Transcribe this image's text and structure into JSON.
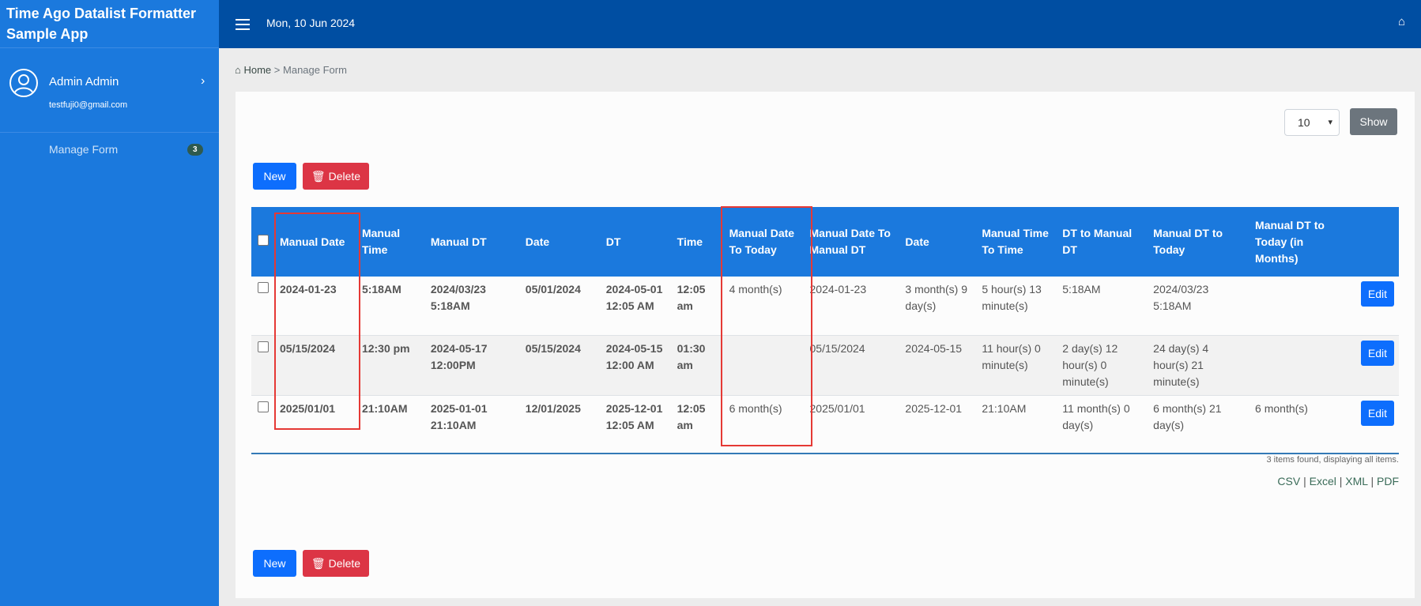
{
  "sidebar": {
    "app_title": "Time Ago Datalist Formatter Sample App",
    "user": {
      "name": "Admin Admin",
      "email": "testfuji0@gmail.com"
    },
    "nav": [
      {
        "label": "Manage Form",
        "badge": "3"
      }
    ]
  },
  "topbar": {
    "date": "Mon, 10 Jun 2024"
  },
  "breadcrumb": {
    "home": "Home",
    "separator": ">",
    "current": "Manage Form"
  },
  "controls": {
    "page_size": "10",
    "show_label": "Show",
    "new_label": "New",
    "delete_label": "Delete"
  },
  "table": {
    "headers": [
      "Manual Date",
      "Manual Time",
      "Manual DT",
      "Date",
      "DT",
      "Time",
      "Manual Date To Today",
      "Manual Date To Manual DT",
      "Date",
      "Manual Time To Time",
      "DT to Manual DT",
      "Manual DT to Today",
      "Manual DT to Today (in Months)"
    ],
    "rows": [
      [
        "2024-01-23",
        "5:18AM",
        "2024/03/23 5:18AM",
        "05/01/2024",
        "2024-05-01 12:05 AM",
        "12:05 am",
        "4 month(s)",
        "2024-01-23",
        "3 month(s) 9 day(s)",
        "5 hour(s) 13 minute(s)",
        "5:18AM",
        "2024/03/23 5:18AM",
        ""
      ],
      [
        "05/15/2024",
        "12:30 pm",
        "2024-05-17 12:00PM",
        "05/15/2024",
        "2024-05-15 12:00 AM",
        "01:30 am",
        "",
        "05/15/2024",
        "2024-05-15",
        "11 hour(s) 0 minute(s)",
        "2 day(s) 12 hour(s) 0 minute(s)",
        "24 day(s) 4 hour(s) 21 minute(s)",
        ""
      ],
      [
        "2025/01/01",
        "21:10AM",
        "2025-01-01 21:10AM",
        "12/01/2025",
        "2025-12-01 12:05 AM",
        "12:05 am",
        "6 month(s)",
        "2025/01/01",
        "2025-12-01",
        "21:10AM",
        "11 month(s) 0 day(s)",
        "6 month(s) 21 day(s)",
        "6 month(s)"
      ]
    ],
    "edit_label": "Edit"
  },
  "footer": {
    "found_text": "3 items found, displaying all items.",
    "exports": [
      "CSV",
      "Excel",
      "XML",
      "PDF"
    ],
    "export_separator": "|"
  },
  "colors": {
    "sidebar": "#1b79dd",
    "topbar": "#004ea2",
    "primary": "#0d6efd",
    "danger": "#dc3545",
    "highlight": "#e53935"
  }
}
